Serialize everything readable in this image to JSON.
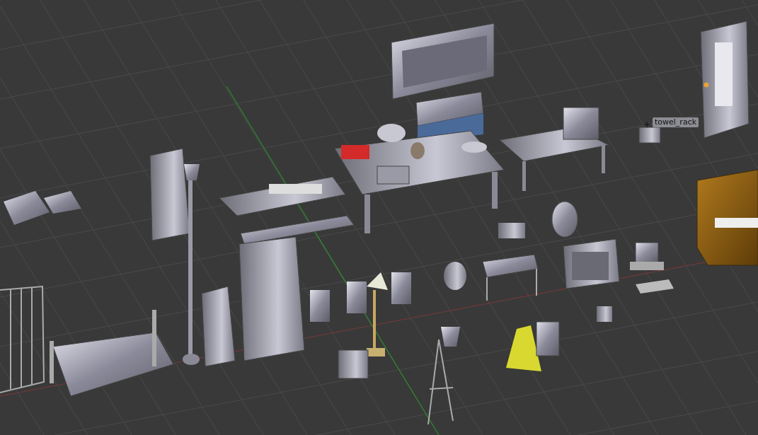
{
  "viewport": {
    "object_label": "towel_rack"
  }
}
